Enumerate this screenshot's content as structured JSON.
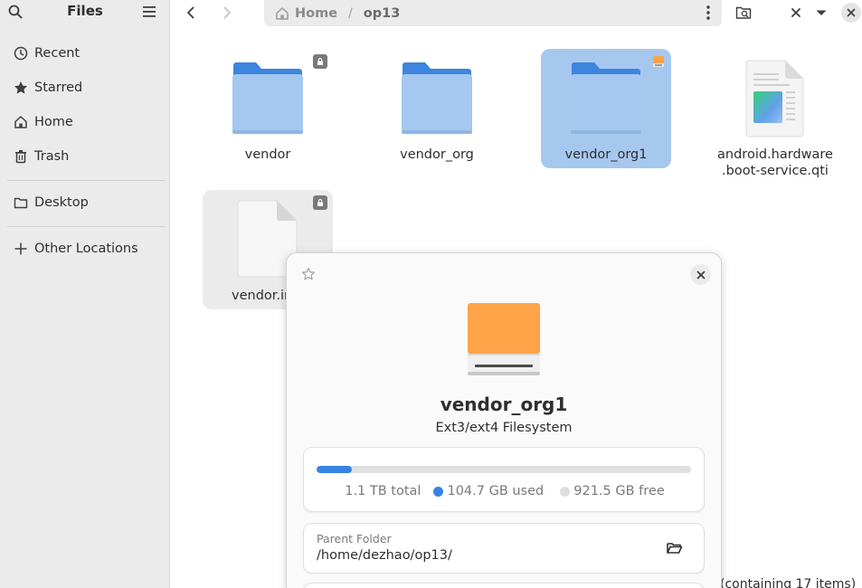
{
  "sidebar": {
    "title": "Files",
    "items": [
      {
        "label": "Recent",
        "icon": "clock-icon"
      },
      {
        "label": "Starred",
        "icon": "star-icon"
      },
      {
        "label": "Home",
        "icon": "home-icon"
      },
      {
        "label": "Trash",
        "icon": "trash-icon"
      },
      {
        "label": "Desktop",
        "icon": "folder-icon"
      },
      {
        "label": "Other Locations",
        "icon": "plus-icon"
      }
    ]
  },
  "header": {
    "breadcrumb": {
      "home": "Home",
      "separator": "/",
      "current": "op13"
    }
  },
  "files": [
    {
      "name": "vendor",
      "type": "folder",
      "emblem": "lock-icon"
    },
    {
      "name": "vendor_org",
      "type": "folder"
    },
    {
      "name": "vendor_org1",
      "type": "folder",
      "selected": true,
      "emblem": "drive-icon"
    },
    {
      "name_line1": "android.hardware",
      "name_line2": ".boot-service.qti",
      "type": "executable"
    },
    {
      "name": "vendor.img",
      "name_visible": "vendor.in",
      "type": "file",
      "emblem": "lock-icon"
    }
  ],
  "properties": {
    "title": "vendor_org1",
    "subtitle": "Ext3/ext4 Filesystem",
    "usage": {
      "total": "1.1 TB total",
      "used": "104.7 GB used",
      "free": "921.5 GB free",
      "used_fraction": 0.095
    },
    "parent_folder": {
      "label": "Parent Folder",
      "value": "/home/dezhao/op13/"
    }
  },
  "status": {
    "text": "(containing 17 items)"
  },
  "colors": {
    "accent": "#3584e4",
    "selection": "#a6c8ef",
    "folder_front": "#a4c8ef",
    "folder_back": "#3d85e0",
    "drive_orange": "#ffa348"
  }
}
